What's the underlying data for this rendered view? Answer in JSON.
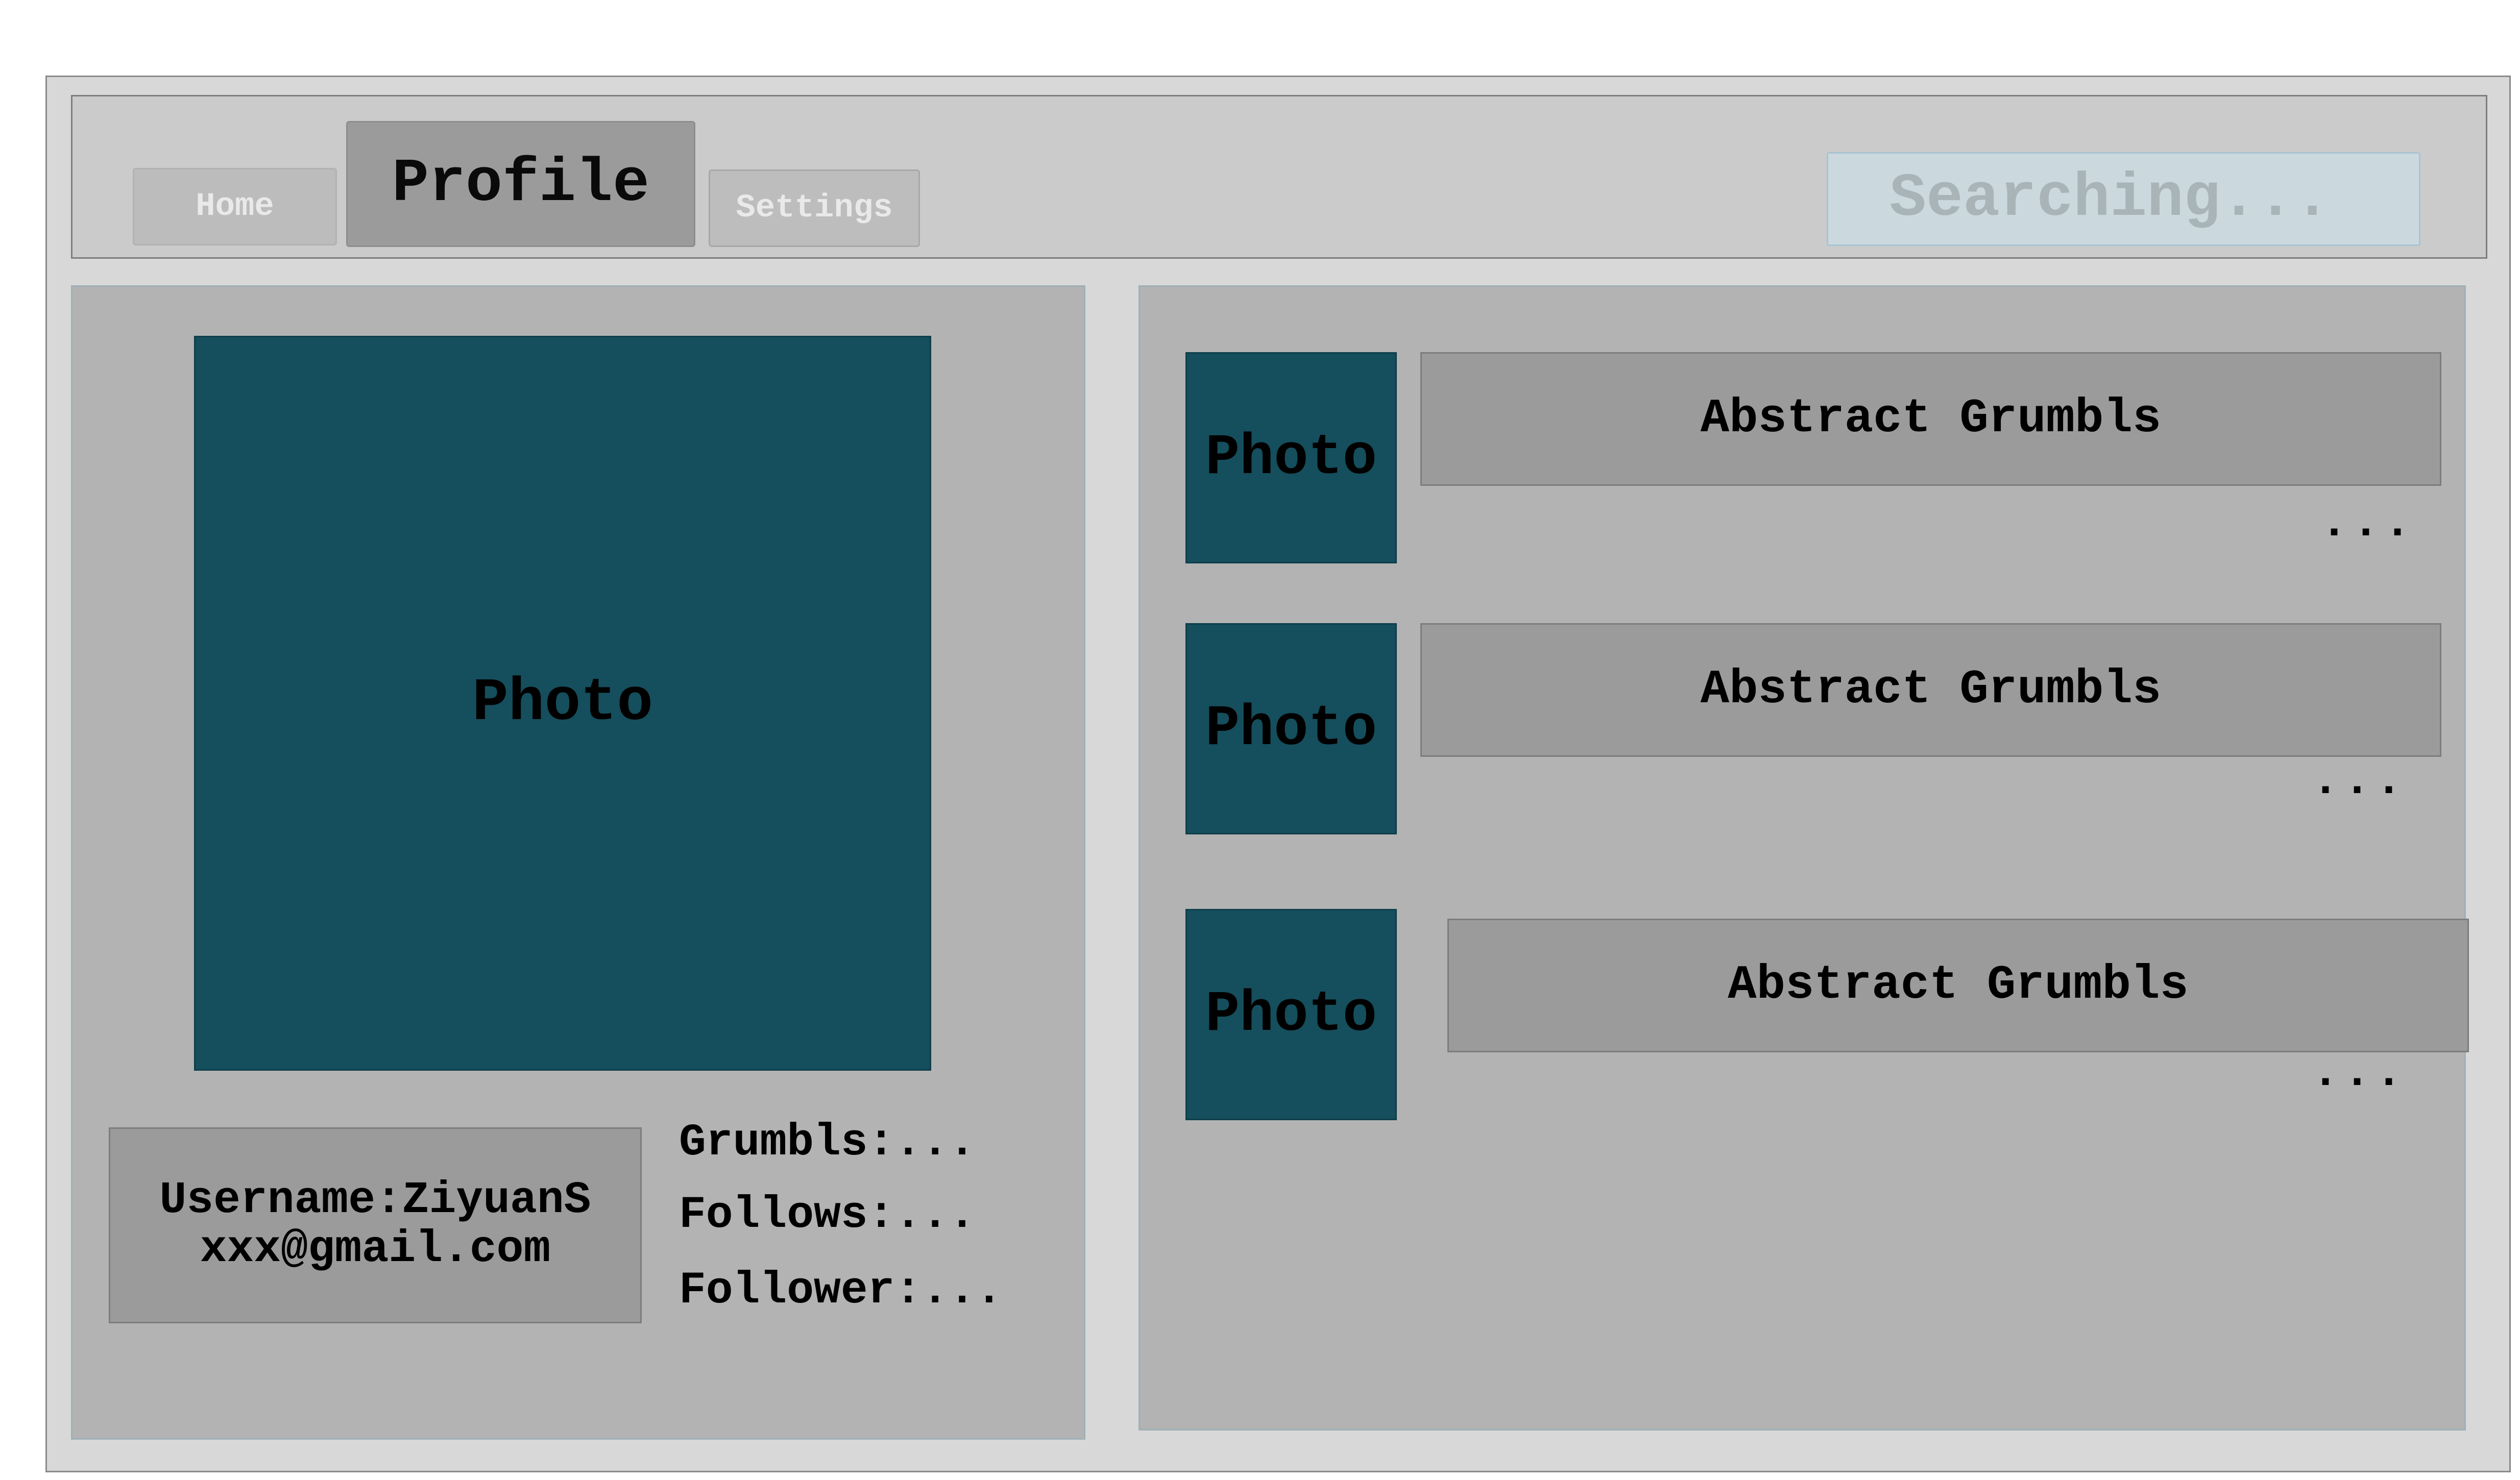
{
  "nav": {
    "tabs": [
      {
        "label": "Home",
        "active": false
      },
      {
        "label": "Profile",
        "active": true
      },
      {
        "label": "Settings",
        "active": false
      }
    ],
    "search": {
      "placeholder": "Searching...",
      "value": ""
    }
  },
  "profile": {
    "photo_label": "Photo",
    "username_line": "Username:ZiyuanS",
    "email": "xxx@gmail.com",
    "stats": {
      "grumbls": "Grumbls:...",
      "follows": "Follows:...",
      "followers": "Follower:..."
    }
  },
  "feed": {
    "items": [
      {
        "photo_label": "Photo",
        "title": "Abstract Grumbls",
        "more": "..."
      },
      {
        "photo_label": "Photo",
        "title": "Abstract Grumbls",
        "more": "..."
      },
      {
        "photo_label": "Photo",
        "title": "Abstract Grumbls",
        "more": "..."
      }
    ]
  },
  "colors": {
    "photo_fill": "#154e5c",
    "panel_bg": "#b3b3b3",
    "card_bg": "#9b9b9b",
    "search_bg": "#cbd9df"
  }
}
